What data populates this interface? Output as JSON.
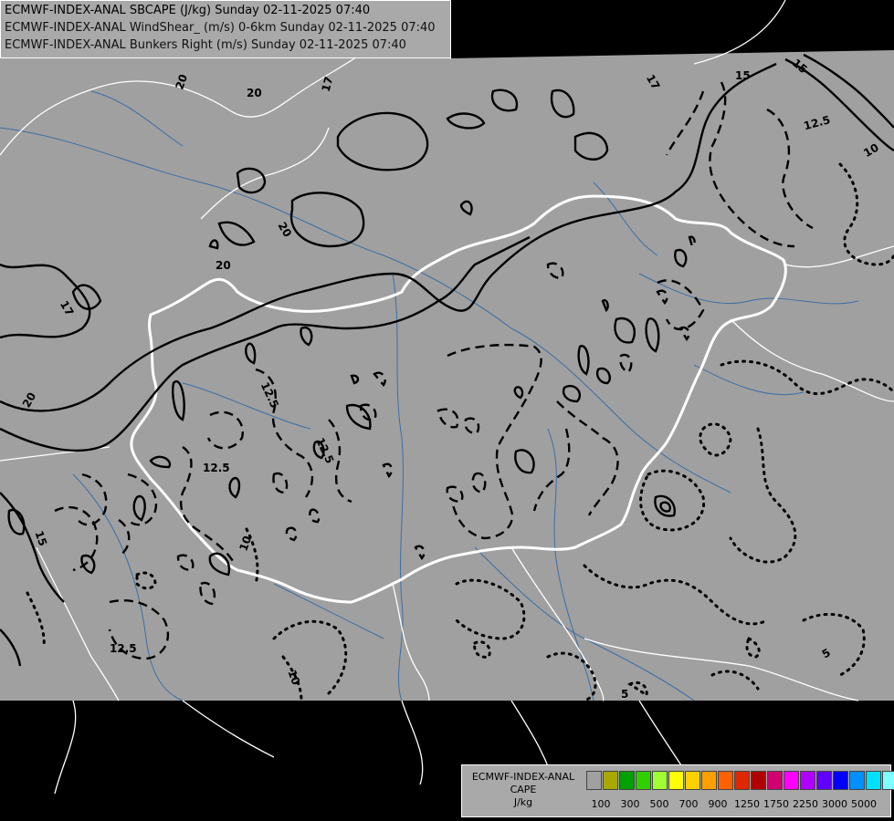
{
  "header": {
    "lines": [
      "ECMWF-INDEX-ANAL SBCAPE (J/kg) Sunday 02-11-2025 07:40",
      "ECMWF-INDEX-ANAL WindShear_ (m/s) 0-6km Sunday 02-11-2025 07:40",
      "ECMWF-INDEX-ANAL Bunkers Right (m/s) Sunday 02-11-2025 07:40"
    ]
  },
  "legend": {
    "title_lines": [
      "ECMWF-INDEX-ANAL",
      "CAPE",
      "J/kg"
    ],
    "colors": [
      "#a0a0a0",
      "#a8a800",
      "#00a000",
      "#30d000",
      "#a0ff30",
      "#ffff00",
      "#ffd000",
      "#ffa000",
      "#ff6000",
      "#e02800",
      "#b00000",
      "#d00070",
      "#ff00ff",
      "#b000ff",
      "#6000ff",
      "#0000ff",
      "#0090ff",
      "#00e0ff",
      "#80ffff",
      "#ffffff"
    ],
    "ticks": [
      "100",
      "300",
      "500",
      "700",
      "900",
      "1250",
      "1750",
      "2250",
      "3000",
      "5000"
    ]
  },
  "contour_labels": [
    {
      "text": "20"
    },
    {
      "text": "20"
    },
    {
      "text": "17"
    },
    {
      "text": "17"
    },
    {
      "text": "15"
    },
    {
      "text": "15"
    },
    {
      "text": "12.5"
    },
    {
      "text": "10"
    },
    {
      "text": "20"
    },
    {
      "text": "20"
    },
    {
      "text": "17"
    },
    {
      "text": "20"
    },
    {
      "text": "12.5"
    },
    {
      "text": "12.5"
    },
    {
      "text": "12.5"
    },
    {
      "text": "15"
    },
    {
      "text": "10"
    },
    {
      "text": "12.5"
    },
    {
      "text": "10"
    },
    {
      "text": "5"
    },
    {
      "text": "5"
    }
  ],
  "colors": {
    "map_background": "#a0a0a0",
    "outside_domain": "#000000",
    "borders": "#ffffff",
    "rivers": "#3a6ea5",
    "contours": "#000000"
  }
}
